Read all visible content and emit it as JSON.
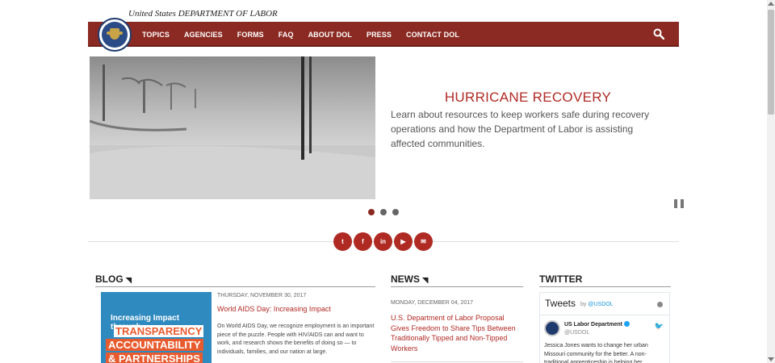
{
  "header": {
    "agency_line": "United States DEPARTMENT OF LABOR",
    "nav": [
      "TOPICS",
      "AGENCIES",
      "FORMS",
      "FAQ",
      "ABOUT DOL",
      "PRESS",
      "CONTACT DOL"
    ],
    "search_icon": "search-icon",
    "colors": {
      "nav_bg": "#8b2a22",
      "accent": "#b02a24"
    }
  },
  "hero": {
    "title": "HURRICANE RECOVERY",
    "description": "Learn about resources to keep workers safe during recovery operations and how the Department of Labor is assisting affected communities.",
    "slides_total": 3,
    "active_slide": 1
  },
  "social": [
    "twitter-icon",
    "facebook-icon",
    "linkedin-icon",
    "youtube-icon",
    "email-icon"
  ],
  "social_glyphs": [
    "t",
    "f",
    "in",
    "▶",
    "✉"
  ],
  "blog": {
    "heading": "BLOG",
    "image_text": [
      "Increasing Impact through",
      "TRANSPARENCY",
      "ACCOUNTABILITY",
      "& PARTNERSHIPS"
    ],
    "date": "THURSDAY, NOVEMBER 30, 2017",
    "title": "World AIDS Day: Increasing Impact",
    "body": "On World AIDS Day, we recognize employment is an important piece of the puzzle. People with HIV/AIDS can and want to work, and research shows the benefits of doing so — to individuals, families, and our nation at large."
  },
  "news": {
    "heading": "NEWS",
    "date": "MONDAY, DECEMBER 04, 2017",
    "title": "U.S. Department of Labor Proposal Gives Freedom to Share Tips Between Traditionally Tipped and Non-Tipped Workers"
  },
  "twitter": {
    "heading": "TWITTER",
    "widget_title": "Tweets",
    "by_label": "by",
    "by_handle": "@USDOL",
    "account_name": "US Labor Department",
    "account_handle": "@USDOL",
    "tweet": "Jessica Jones wants to change her urban Missouri community for the better. A non-traditional apprenticeship is helping her..."
  }
}
